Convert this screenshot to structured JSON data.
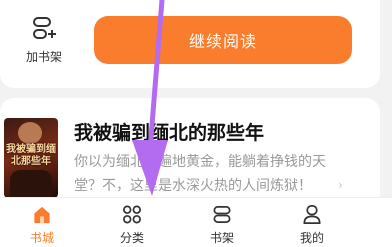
{
  "top_bar": {
    "add_shelf_label": "加书架",
    "continue_label": "继续阅读",
    "accent": "#f97d2c"
  },
  "book": {
    "cover_text": "我被骗到缅北那些年",
    "title": "我被骗到缅北的那些年",
    "description": "你以为缅北是遍地黄金，能躺着挣钱的天堂？不，这里是水深火热的人间炼狱！",
    "chevron": "›"
  },
  "tabbar": {
    "tabs": [
      {
        "label": "书城",
        "icon": "home-icon",
        "active": true
      },
      {
        "label": "分类",
        "icon": "category-grid-icon",
        "active": false
      },
      {
        "label": "书架",
        "icon": "bookshelf-icon",
        "active": false
      },
      {
        "label": "我的",
        "icon": "profile-icon",
        "active": false
      }
    ]
  },
  "overlay": {
    "arrow_color": "#b36cf0"
  }
}
